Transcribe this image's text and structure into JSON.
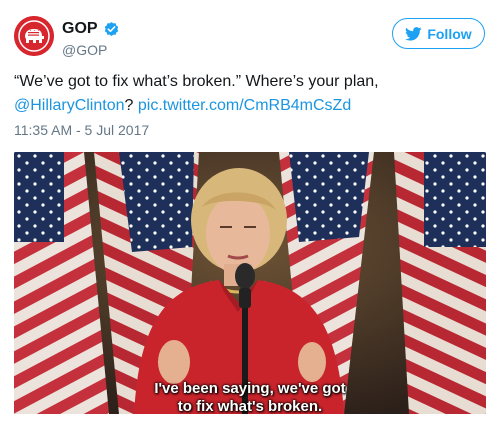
{
  "tweet": {
    "display_name": "GOP",
    "handle": "@GOP",
    "follow_label": "Follow",
    "text_quote": "“We’ve got to fix what’s broken.” Where’s your plan,",
    "mention": "@HillaryClinton",
    "text_mid": "?",
    "link": "pic.twitter.com/CmRB4mCsZd",
    "timestamp": "11:35 AM - 5 Jul 2017"
  },
  "media": {
    "caption_line1": "I've been saying, we've got",
    "caption_line2": "to fix what's broken."
  },
  "icons": {
    "avatar": "elephant-logo-icon",
    "verified": "verified-badge-icon",
    "follow": "twitter-bird-icon"
  },
  "colors": {
    "accent": "#1da1f2",
    "link": "#1b95e0",
    "brand_red": "#d8262e",
    "muted": "#657786"
  }
}
